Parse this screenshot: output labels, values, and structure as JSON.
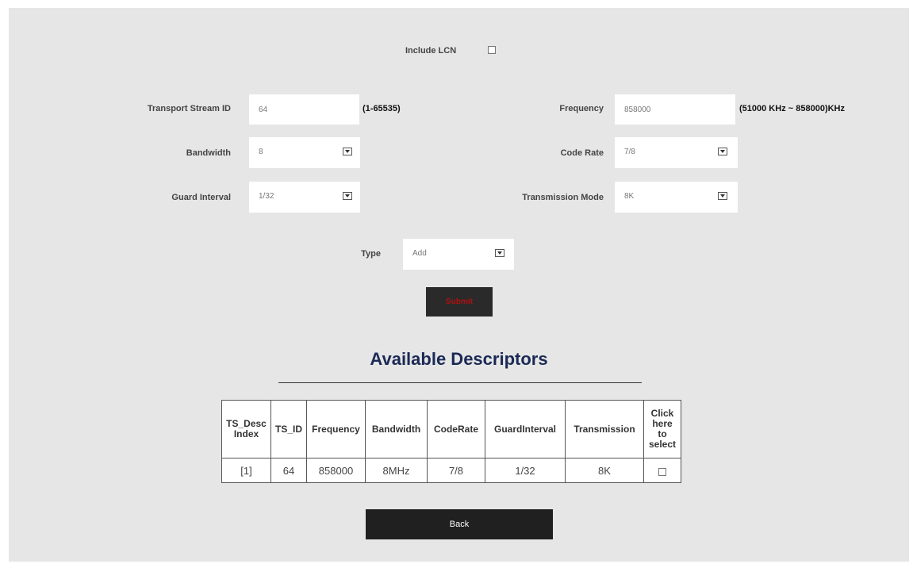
{
  "lcn": {
    "label": "Include LCN"
  },
  "form": {
    "transport_stream_id": {
      "label": "Transport Stream ID",
      "value": "64",
      "hint": "(1-65535)"
    },
    "frequency": {
      "label": "Frequency",
      "value": "858000",
      "hint": "(51000 KHz ~ 858000)KHz"
    },
    "bandwidth": {
      "label": "Bandwidth",
      "value": "8"
    },
    "code_rate": {
      "label": "Code Rate",
      "value": "7/8"
    },
    "guard_interval": {
      "label": "Guard Interval",
      "value": "1/32"
    },
    "transmission_mode": {
      "label": "Transmission Mode",
      "value": "8K"
    },
    "type": {
      "label": "Type",
      "value": "Add"
    },
    "submit_label": "Submit"
  },
  "descriptors": {
    "heading": "Available Descriptors",
    "columns": [
      "TS_Desc Index",
      "TS_ID",
      "Frequency",
      "Bandwidth",
      "CodeRate",
      "GuardInterval",
      "Transmission",
      "Click here to select"
    ],
    "rows": [
      [
        "[1]",
        "64",
        "858000",
        "8MHz",
        "7/8",
        "1/32",
        "8K"
      ]
    ]
  },
  "back_label": "Back",
  "colors": {
    "panel": "#e6e6e6",
    "heading": "#1b2a55",
    "submit_text": "#b01010"
  }
}
